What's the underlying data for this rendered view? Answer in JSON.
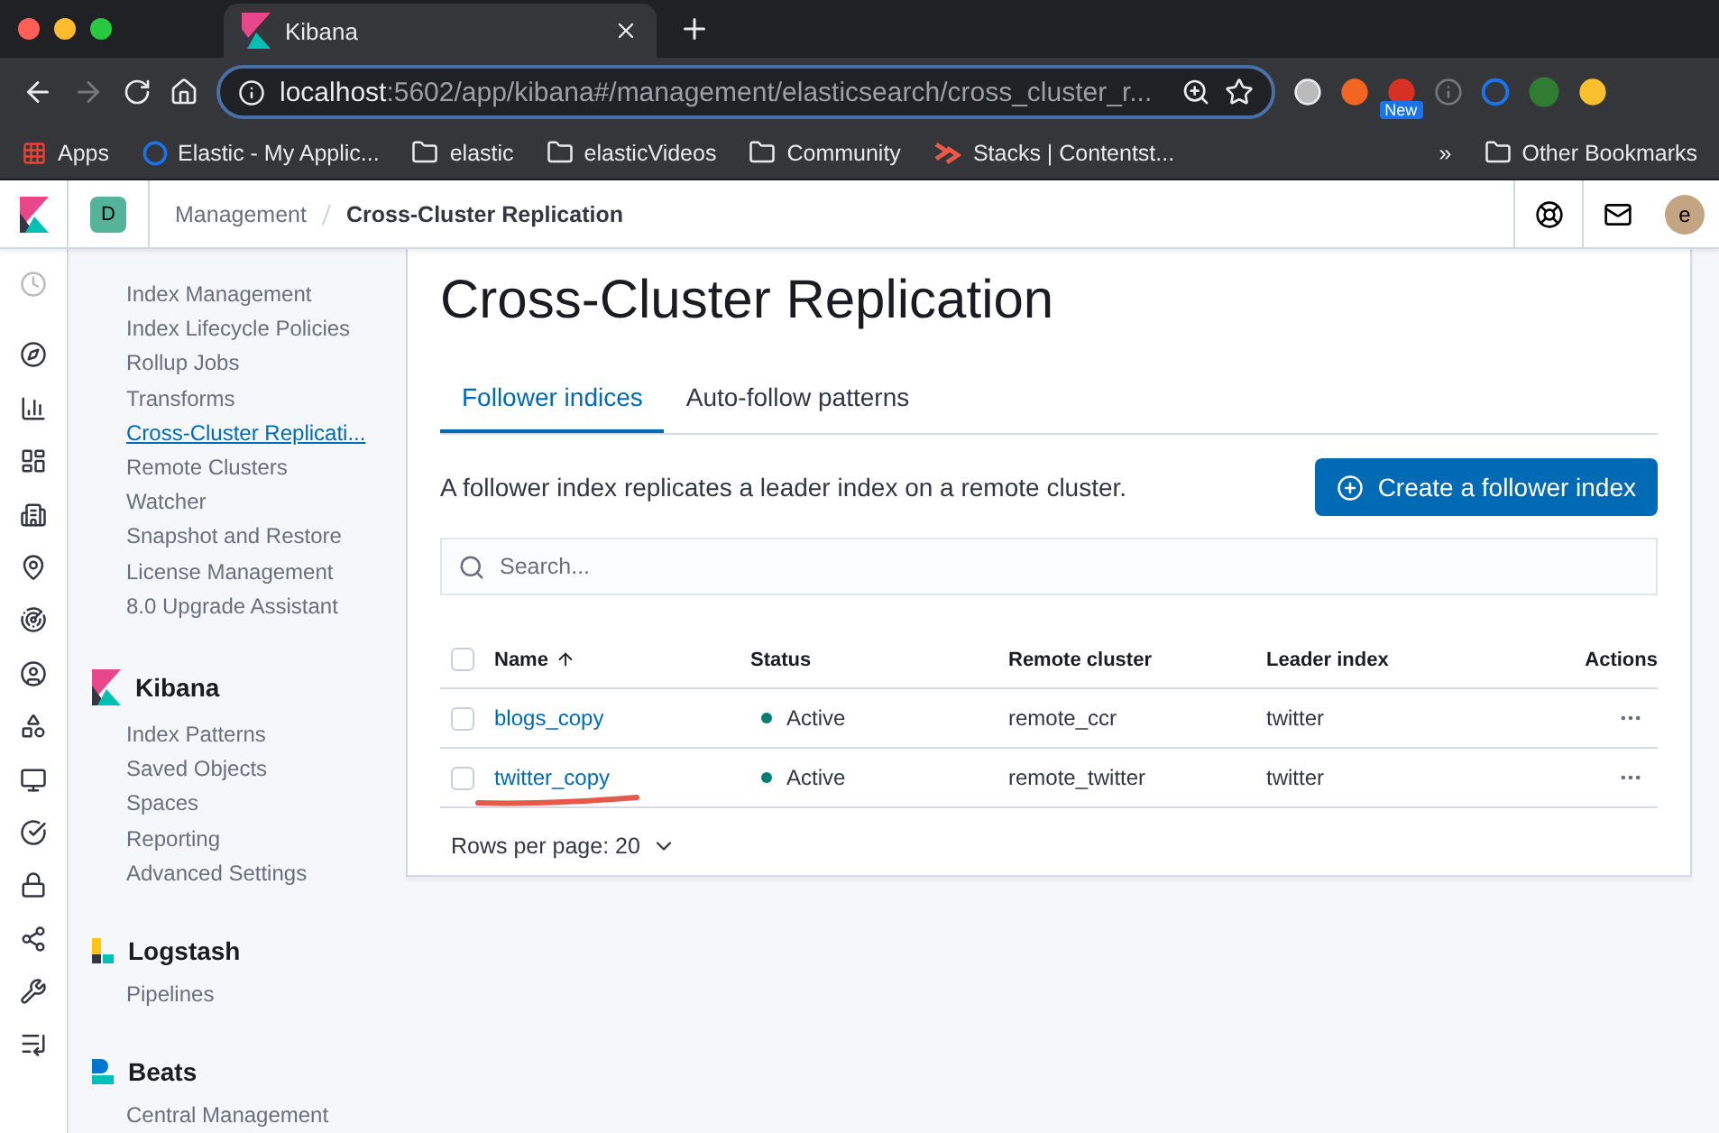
{
  "browser": {
    "tab_title": "Kibana",
    "url_host": "localhost",
    "url_path": ":5602/app/kibana#/management/elasticsearch/cross_cluster_r...",
    "extension_badge": "New",
    "bookmarks": [
      {
        "label": "Apps",
        "kind": "apps"
      },
      {
        "label": "Elastic - My Applic...",
        "kind": "site"
      },
      {
        "label": "elastic",
        "kind": "folder"
      },
      {
        "label": "elasticVideos",
        "kind": "folder"
      },
      {
        "label": "Community",
        "kind": "folder"
      },
      {
        "label": "Stacks | Contentst...",
        "kind": "stacks"
      }
    ],
    "overflow": "»",
    "other_bookmarks": "Other Bookmarks"
  },
  "header": {
    "space": "D",
    "breadcrumbs": [
      "Management",
      "Cross-Cluster Replication"
    ],
    "avatar": "e"
  },
  "sidebar": {
    "sections": [
      {
        "items": [
          {
            "label": "Index Management",
            "selected": false
          },
          {
            "label": "Index Lifecycle Policies",
            "selected": false
          },
          {
            "label": "Rollup Jobs",
            "selected": false
          },
          {
            "label": "Transforms",
            "selected": false
          },
          {
            "label": "Cross-Cluster Replicati...",
            "selected": true
          },
          {
            "label": "Remote Clusters",
            "selected": false
          },
          {
            "label": "Watcher",
            "selected": false
          },
          {
            "label": "Snapshot and Restore",
            "selected": false
          },
          {
            "label": "License Management",
            "selected": false
          },
          {
            "label": "8.0 Upgrade Assistant",
            "selected": false
          }
        ]
      },
      {
        "kind": "kibana",
        "title": "Kibana",
        "items": [
          {
            "label": "Index Patterns",
            "selected": false
          },
          {
            "label": "Saved Objects",
            "selected": false
          },
          {
            "label": "Spaces",
            "selected": false
          },
          {
            "label": "Reporting",
            "selected": false
          },
          {
            "label": "Advanced Settings",
            "selected": false
          }
        ]
      },
      {
        "kind": "logstash",
        "title": "Logstash",
        "items": [
          {
            "label": "Pipelines",
            "selected": false
          }
        ]
      },
      {
        "kind": "beats",
        "title": "Beats",
        "items": [
          {
            "label": "Central Management",
            "selected": false
          }
        ]
      }
    ]
  },
  "page": {
    "title": "Cross-Cluster Replication",
    "tabs": [
      {
        "label": "Follower indices",
        "selected": true
      },
      {
        "label": "Auto-follow patterns",
        "selected": false
      }
    ],
    "description": "A follower index replicates a leader index on a remote cluster.",
    "create_button": "Create a follower index",
    "search": {
      "placeholder": "Search..."
    },
    "table": {
      "select_all_checked": false,
      "columns": [
        {
          "label": "Name",
          "sorted": true
        },
        {
          "label": "Status",
          "sorted": false
        },
        {
          "label": "Remote cluster",
          "sorted": false
        },
        {
          "label": "Leader index",
          "sorted": false
        },
        {
          "label": "Actions",
          "sorted": false
        }
      ],
      "rows": [
        {
          "name": "blogs_copy",
          "status": "Active",
          "color": "#017d73",
          "remote_cluster": "remote_ccr",
          "leader_index": "twitter",
          "checked": false,
          "annotated": false
        },
        {
          "name": "twitter_copy",
          "status": "Active",
          "color": "#017d73",
          "remote_cluster": "remote_twitter",
          "leader_index": "twitter",
          "checked": false,
          "annotated": true
        }
      ]
    },
    "pagination": "Rows per page: 20"
  }
}
